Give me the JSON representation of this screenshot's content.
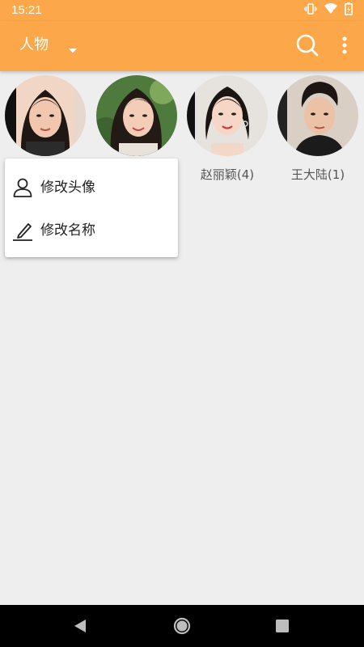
{
  "status_bar": {
    "time": "15:21",
    "icons": [
      "vibrate-icon",
      "wifi-icon",
      "battery-charging-icon"
    ]
  },
  "app_bar": {
    "title": "人物",
    "dropdown_icon": "caret-down-icon",
    "actions": [
      "search-icon",
      "more-vert-icon"
    ]
  },
  "people": [
    {
      "name": "",
      "avatar": "avatar-1"
    },
    {
      "name": "",
      "avatar": "avatar-2"
    },
    {
      "name": "赵丽颖(4)",
      "avatar": "avatar-3"
    },
    {
      "name": "王大陆(1)",
      "avatar": "avatar-4"
    }
  ],
  "popup_menu": {
    "items": [
      {
        "label": "修改头像",
        "icon": "person-icon"
      },
      {
        "label": "修改名称",
        "icon": "edit-pencil-icon"
      }
    ]
  },
  "nav_bar": {
    "buttons": [
      "back-icon",
      "home-icon",
      "recents-icon"
    ]
  },
  "colors": {
    "accent": "#fca84a",
    "background": "#eeeeee",
    "menu_background": "#ffffff",
    "nav_background": "#000000"
  }
}
